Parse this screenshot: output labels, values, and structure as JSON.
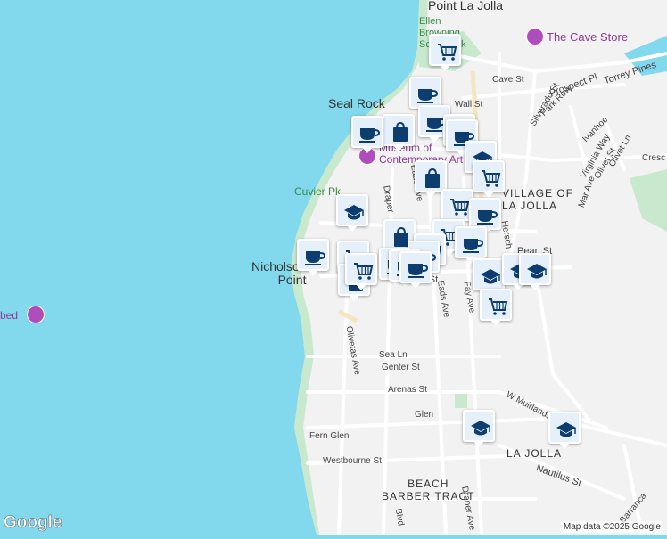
{
  "map": {
    "places": {
      "point_la_jolla": "Point La Jolla",
      "ellen_browning": "Ellen\nBrowning\nScripps Pk",
      "seal_rock": "Seal Rock",
      "cuvier_pk": "Cuvier Pk",
      "nicholson_point": "Nicholson\nPoint",
      "bed": "bed",
      "museum": "Museum of\nContemporary Art",
      "cave_store": "The Cave Store"
    },
    "neighborhoods": {
      "village": "VILLAGE OF\nLA JOLLA",
      "la_jolla": "LA JOLLA",
      "beach_barber": "BEACH\nBARBER TRACT"
    },
    "streets": {
      "cave_st": "Cave St",
      "prospect_pl": "Prospect Pl",
      "torrey_pines": "Torrey Pines",
      "wall_st": "Wall St",
      "silverado_st": "Silverado St",
      "park_row": "Park Row",
      "ivanhoe": "Ivanhoe",
      "virginia_way": "Virginia Way",
      "olivet_st": "Olivet St",
      "olivet_ln": "Olivet Ln",
      "mar_ave": "Mar Ave",
      "cresc": "Cresc",
      "draper": "Draper",
      "eads_ave": "Eads Ave",
      "eads_ave2": "Eads Ave",
      "herschel": "Hersch",
      "pearl_st": "Pearl St",
      "pearl_st2": "Pearl St",
      "fay_ave": "Fay Ave",
      "olivetas_ave": "Olivetas Ave",
      "sea_ln": "Sea Ln",
      "genter_st": "Genter St",
      "arenas_st": "Arenas St",
      "w_muirlands": "W Muirlands",
      "fern_glen": "Fern Glen",
      "glen": "Glen",
      "westbourne_st": "Westbourne St",
      "nautilus_st": "Nautilus St",
      "draper_ave": "Draper Ave",
      "blvd": "Blvd",
      "barranca": "Barranca"
    },
    "attribution": "Map data ©2025 Google",
    "logo": "Google"
  },
  "markers": [
    {
      "type": "grocery"
    },
    {
      "type": "coffee"
    },
    {
      "type": "coffee"
    },
    {
      "type": "shopping"
    },
    {
      "type": "coffee"
    },
    {
      "type": "coffee"
    },
    {
      "type": "coffee"
    },
    {
      "type": "school"
    },
    {
      "type": "grocery"
    },
    {
      "type": "shopping"
    },
    {
      "type": "grocery"
    },
    {
      "type": "school"
    },
    {
      "type": "coffee"
    },
    {
      "type": "shopping"
    },
    {
      "type": "grocery"
    },
    {
      "type": "coffee"
    },
    {
      "type": "coffee"
    },
    {
      "type": "grocery"
    },
    {
      "type": "coffee"
    },
    {
      "type": "grocery"
    },
    {
      "type": "coffee"
    },
    {
      "type": "coffee"
    },
    {
      "type": "coffee"
    },
    {
      "type": "shopping"
    },
    {
      "type": "school"
    },
    {
      "type": "school"
    },
    {
      "type": "school"
    },
    {
      "type": "grocery"
    },
    {
      "type": "grocery"
    },
    {
      "type": "school"
    },
    {
      "type": "school"
    }
  ],
  "colors": {
    "water": "#82d8ec",
    "land": "#f2f2f2",
    "park": "#c9e9cf",
    "road": "#ffffff",
    "marker_bg": "#e6f0fb",
    "icon": "#0d3d6e",
    "poi": "#8e3a99"
  }
}
